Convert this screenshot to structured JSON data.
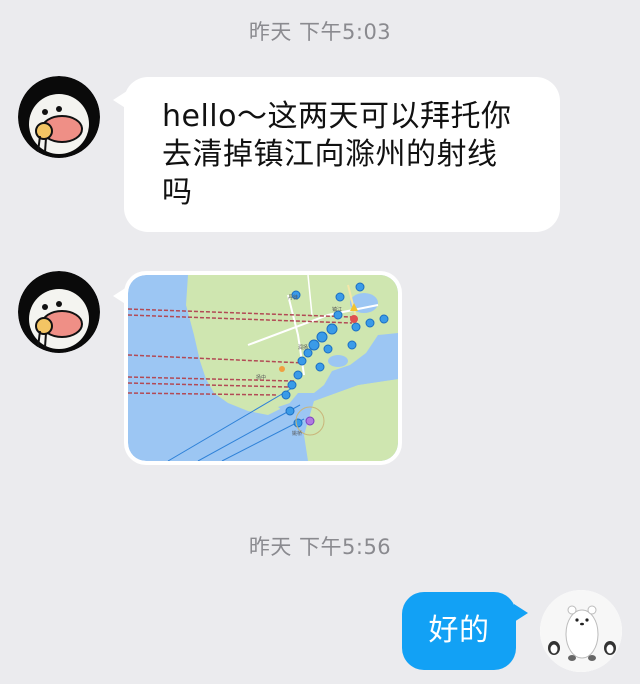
{
  "conversation": {
    "timestamps": [
      "昨天 下午5:03",
      "昨天 下午5:56"
    ],
    "messages": [
      {
        "sender": "other",
        "type": "text",
        "text": "hello～这两天可以拜托你去清掉镇江向滁州的射线吗",
        "lines": [
          "hello～这两天可以拜托你",
          "去清掉镇江向滁州的射线",
          "吗"
        ]
      },
      {
        "sender": "other",
        "type": "image",
        "image_description": "map-screenshot",
        "map_labels": [
          "镇江",
          "丹徒",
          "润扬",
          "扬中",
          "姚桥"
        ]
      },
      {
        "sender": "me",
        "type": "text",
        "text": "好的"
      }
    ]
  },
  "colors": {
    "background": "#ebebee",
    "incoming_bubble": "#ffffff",
    "outgoing_bubble": "#12a1f5",
    "timestamp_text": "#8a8a8f"
  },
  "icons": {
    "other_avatar": "cartoon-penguin-eating-avatar",
    "my_avatar": "polar-bear-with-penguins-avatar"
  }
}
